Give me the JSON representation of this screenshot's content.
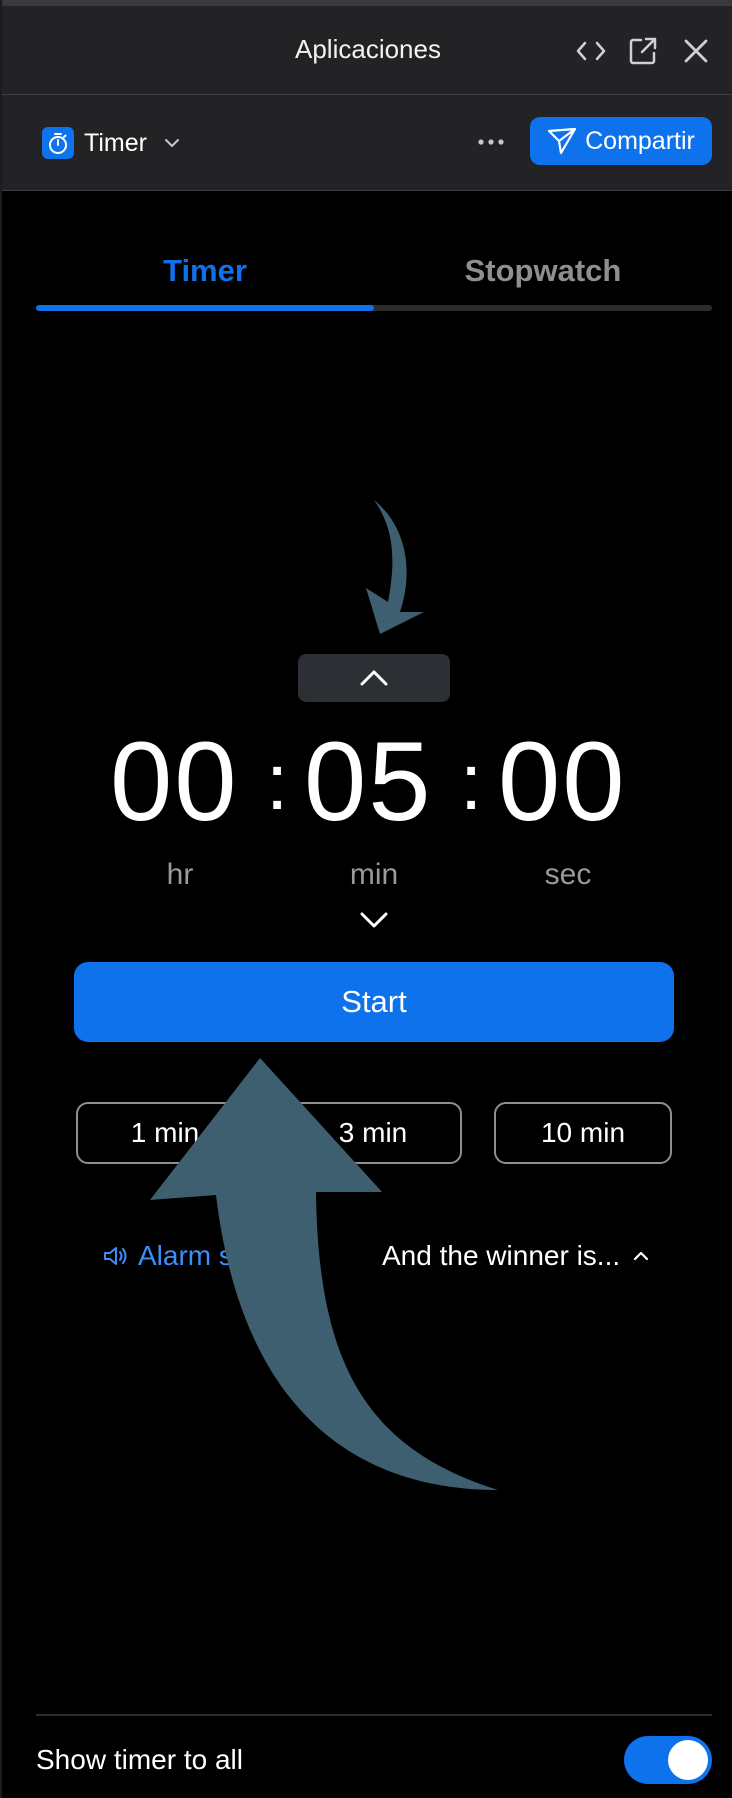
{
  "window": {
    "title": "Aplicaciones"
  },
  "app_header": {
    "app_name": "Timer",
    "share_label": "Compartir"
  },
  "tabs": [
    {
      "label": "Timer",
      "active": true
    },
    {
      "label": "Stopwatch",
      "active": false
    }
  ],
  "timer": {
    "hours": "00",
    "minutes": "05",
    "seconds": "00",
    "separator": ":",
    "unit_hr": "hr",
    "unit_min": "min",
    "unit_sec": "sec",
    "start_label": "Start"
  },
  "presets": [
    {
      "label": "1 min"
    },
    {
      "label": "3 min"
    },
    {
      "label": "10 min"
    }
  ],
  "options": {
    "alarm_label": "Alarm s",
    "sound_label": "And the winner is..."
  },
  "footer": {
    "show_timer_label": "Show timer to all",
    "show_timer_on": true
  },
  "colors": {
    "accent": "#0e72ed",
    "background": "#000000",
    "header": "#232325",
    "annotation_arrow": "#3e5f6f"
  }
}
